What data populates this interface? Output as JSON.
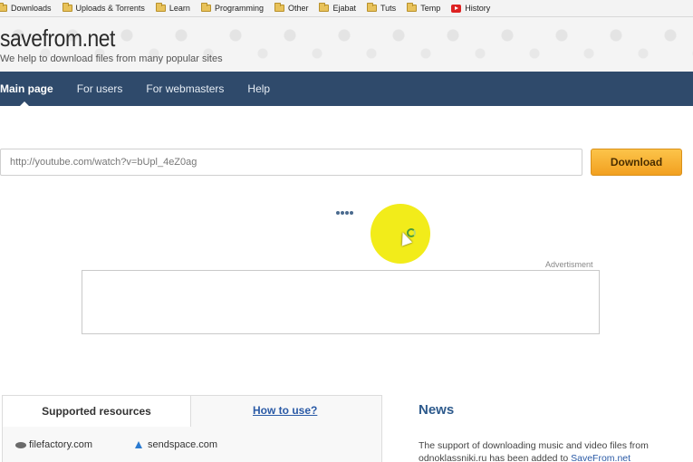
{
  "bookmarks": [
    {
      "label": "Downloads",
      "icon": "folder-icon"
    },
    {
      "label": "Uploads & Torrents",
      "icon": "folder-icon"
    },
    {
      "label": "Learn",
      "icon": "folder-icon"
    },
    {
      "label": "Programming",
      "icon": "folder-icon"
    },
    {
      "label": "Other",
      "icon": "folder-icon"
    },
    {
      "label": "Ejabat",
      "icon": "folder-icon"
    },
    {
      "label": "Tuts",
      "icon": "folder-icon"
    },
    {
      "label": "Temp",
      "icon": "folder-icon"
    },
    {
      "label": "History",
      "icon": "youtube-icon"
    }
  ],
  "header": {
    "logo": "savefrom.net",
    "tagline": "We help to download files from many popular sites"
  },
  "nav": [
    {
      "label": "Main page",
      "active": true
    },
    {
      "label": "For users",
      "active": false
    },
    {
      "label": "For webmasters",
      "active": false
    },
    {
      "label": "Help",
      "active": false
    }
  ],
  "search": {
    "value": "http://youtube.com/watch?v=bUpl_4eZ0ag",
    "button_label": "Download"
  },
  "ad": {
    "label": "Advertisment"
  },
  "resources": {
    "tab_supported": "Supported resources",
    "tab_howto": "How to use?",
    "items": [
      "filefactory.com",
      "sendspace.com"
    ]
  },
  "news": {
    "title": "News",
    "text_line1": "The support of downloading music and video files from",
    "text_line2": "odnoklassniki.ru has been added to ",
    "link": "SaveFrom.net"
  },
  "colors": {
    "nav_bg": "#2f4a6b",
    "download_button": "#f7b733",
    "cursor_highlight": "#f2ec1a",
    "link": "#2a5aa6"
  }
}
